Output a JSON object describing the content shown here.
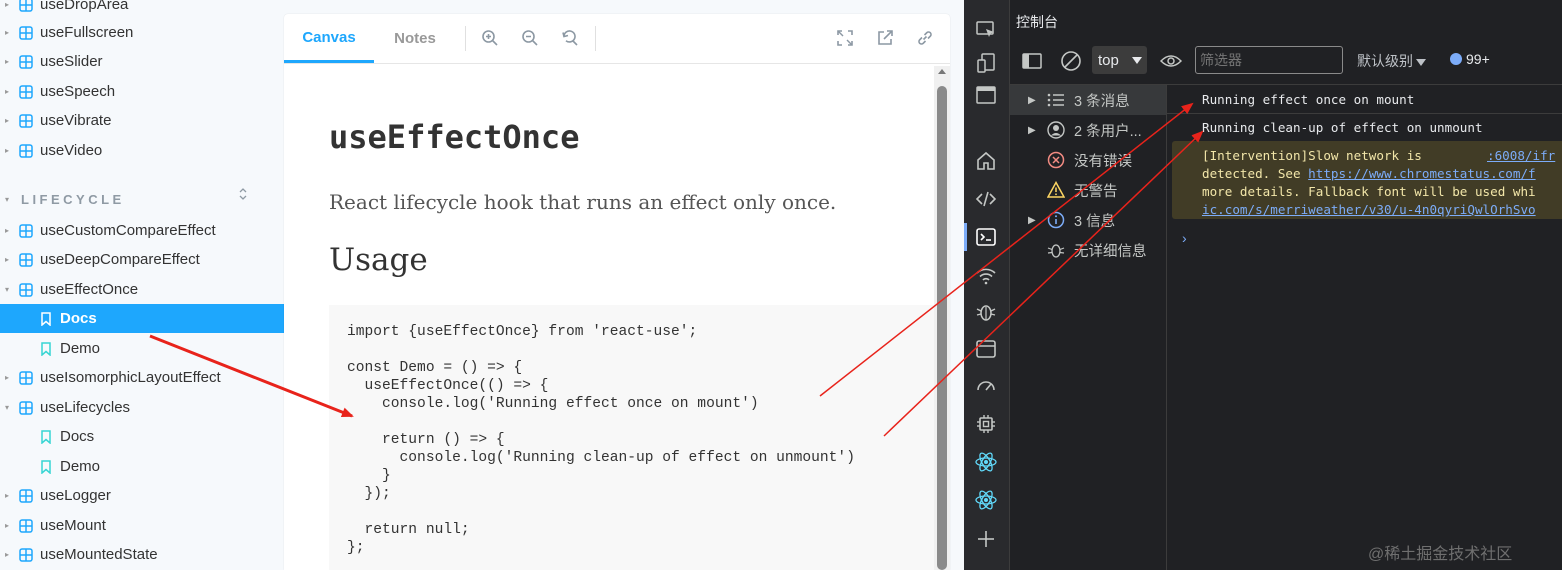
{
  "sidebar": {
    "items_top": [
      {
        "label": "useDropArea"
      },
      {
        "label": "useFullscreen"
      },
      {
        "label": "useSlider"
      },
      {
        "label": "useSpeech"
      },
      {
        "label": "useVibrate"
      },
      {
        "label": "useVideo"
      }
    ],
    "section_title": "LIFECYCLE",
    "items_lifecycle": [
      {
        "label": "useCustomCompareEffect"
      },
      {
        "label": "useDeepCompareEffect"
      },
      {
        "label": "useEffectOnce"
      },
      {
        "label": "Docs"
      },
      {
        "label": "Demo"
      },
      {
        "label": "useIsomorphicLayoutEffect"
      },
      {
        "label": "useLifecycles"
      },
      {
        "label": "Docs"
      },
      {
        "label": "Demo"
      },
      {
        "label": "useLogger"
      },
      {
        "label": "useMount"
      },
      {
        "label": "useMountedState"
      }
    ]
  },
  "preview": {
    "tabs": [
      {
        "label": "Canvas"
      },
      {
        "label": "Notes"
      }
    ],
    "docs": {
      "title": "useEffectOnce",
      "description": "React lifecycle hook that runs an effect only once.",
      "usage_heading": "Usage",
      "code": "import {useEffectOnce} from 'react-use';\n\nconst Demo = () => {\n  useEffectOnce(() => {\n    console.log('Running effect once on mount')\n\n    return () => {\n      console.log('Running clean-up of effect on unmount')\n    }\n  });\n\n  return null;\n};"
    }
  },
  "devtools": {
    "title": "控制台",
    "context": "top",
    "filter_placeholder": "筛选器",
    "level": "默认级别",
    "issues_count": "99+",
    "sidebar": [
      {
        "label": "3 条消息"
      },
      {
        "label": "2 条用户..."
      },
      {
        "label": "没有错误"
      },
      {
        "label": "无警告"
      },
      {
        "label": "3 信息"
      },
      {
        "label": "无详细信息"
      }
    ],
    "logs": [
      {
        "text": "Running effect once on mount"
      },
      {
        "text": "Running clean-up of effect on unmount"
      }
    ],
    "warning": {
      "line1_a": "[Intervention]Slow network is",
      "line1_link": ":6008/ifr",
      "line2_a": "detected. See ",
      "line2_link": "https://www.chromestatus.com/f",
      "line3": "more details. Fallback font will be used whi",
      "line4_link": "ic.com/s/merriweather/v30/u-4n0qyriQwlOrhSvo"
    }
  },
  "watermark": "@稀土掘金技术社区",
  "colors": {
    "accent": "#1ea7fd",
    "annotation": "#e8231b",
    "devtools_bg": "#202124"
  }
}
